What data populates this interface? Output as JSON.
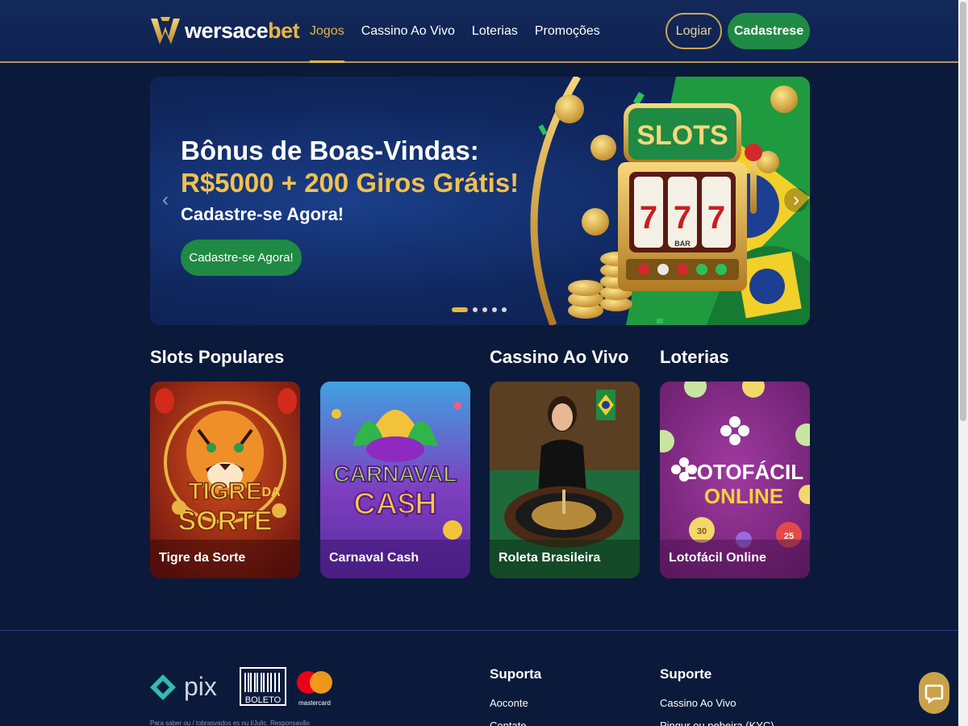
{
  "brand": {
    "name_white": "wersace",
    "name_gold": "bet"
  },
  "nav": {
    "items": [
      {
        "label": "Jogos",
        "active": true
      },
      {
        "label": "Cassino Ao Vivo",
        "active": false
      },
      {
        "label": "Loterias",
        "active": false
      },
      {
        "label": "Promoções",
        "active": false
      }
    ]
  },
  "auth": {
    "login_label": "Logiar",
    "signup_label": "Cadastrese"
  },
  "hero": {
    "title_line1": "Bônus de Boas-Vindas:",
    "title_line2": "R$5000 + 200 Giros Grátis!",
    "subtitle": "Cadastre-se Agora!",
    "cta_label": "Cadastre-se Agora!",
    "machine_text": "SLOTS",
    "reels": [
      "7",
      "7",
      "7"
    ],
    "reel_tag": "BAR",
    "slide_count": 5,
    "active_slide": 1
  },
  "sections": {
    "slots_title": "Slots Populares",
    "live_title": "Cassino Ao Vivo",
    "lottery_title": "Loterias"
  },
  "games": [
    {
      "label": "Tigre da Sorte",
      "art_line1": "TIGRE",
      "art_line2": "DA",
      "art_line3": "SORTE"
    },
    {
      "label": "Carnaval Cash",
      "art_line1": "CARNAVAL",
      "art_line2": "CA$H"
    },
    {
      "label": "Roleta Brasileira"
    },
    {
      "label": "Lotofácil Online",
      "art_line1": "LOTOFÁCIL",
      "art_line2": "ONLINE",
      "ball1": "30",
      "ball2": "25"
    }
  ],
  "footer": {
    "payments": {
      "pix": "pix",
      "boleto": "BOLETO",
      "mastercard": "mastercard"
    },
    "col1_title": "Suporta",
    "col1_links": [
      "Aoconte",
      "Contate"
    ],
    "col2_title": "Suporte",
    "col2_links": [
      "Cassino Ao Vivo",
      "Pingur ou pebeira (KYC)"
    ],
    "legal": "Para saber ou / tobrasvados es nu l/Julic. Responsavão"
  },
  "colors": {
    "gold": "#e8b640",
    "green": "#1f8a43",
    "navy": "#0b1a3a"
  }
}
